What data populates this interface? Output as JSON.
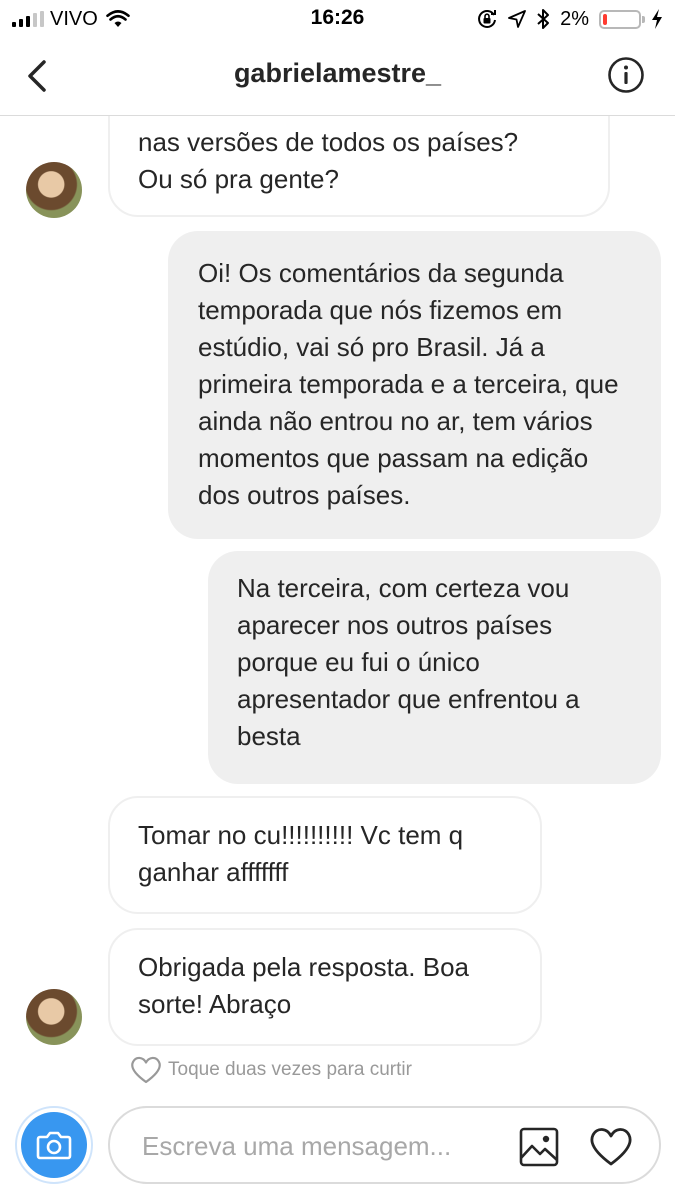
{
  "status_bar": {
    "carrier": "VIVO",
    "time": "16:26",
    "battery_percent": "2%",
    "battery_level": 0.02,
    "signal_bars_filled": 3,
    "signal_bars_total": 5,
    "icons": [
      "wifi-icon",
      "orientation-lock-icon",
      "location-icon",
      "bluetooth-icon",
      "battery-icon",
      "charging-bolt-icon"
    ]
  },
  "header": {
    "title": "gabrielamestre_",
    "back_icon": "chevron-left-icon",
    "info_icon": "info-icon"
  },
  "messages": [
    {
      "direction": "incoming",
      "text": "nas versões de todos os países?\nOu só pra gente?",
      "partial": true
    },
    {
      "direction": "outgoing",
      "text": "Oi! Os comentários da segunda temporada que nós fizemos em estúdio, vai só pro Brasil. Já a primeira temporada e a terceira, que ainda não entrou no ar, tem vários momentos que passam na edição dos outros países."
    },
    {
      "direction": "outgoing",
      "text": "Na terceira, com certeza vou aparecer nos outros países porque eu fui o único apresentador que enfrentou a besta"
    },
    {
      "direction": "incoming",
      "text": "Tomar no cu!!!!!!!!!! Vc tem q ganhar afffffff"
    },
    {
      "direction": "incoming",
      "text": "Obrigada pela resposta. Boa sorte! Abraço"
    }
  ],
  "like_hint": "Toque duas vezes para curtir",
  "composer": {
    "placeholder": "Escreva uma mensagem...",
    "icons": [
      "camera-icon",
      "gallery-icon",
      "heart-icon"
    ]
  },
  "colors": {
    "accent": "#3897f0",
    "bubble_outgoing": "#efefef",
    "bubble_incoming_border": "#efefef",
    "battery_low": "#ff3b30"
  }
}
